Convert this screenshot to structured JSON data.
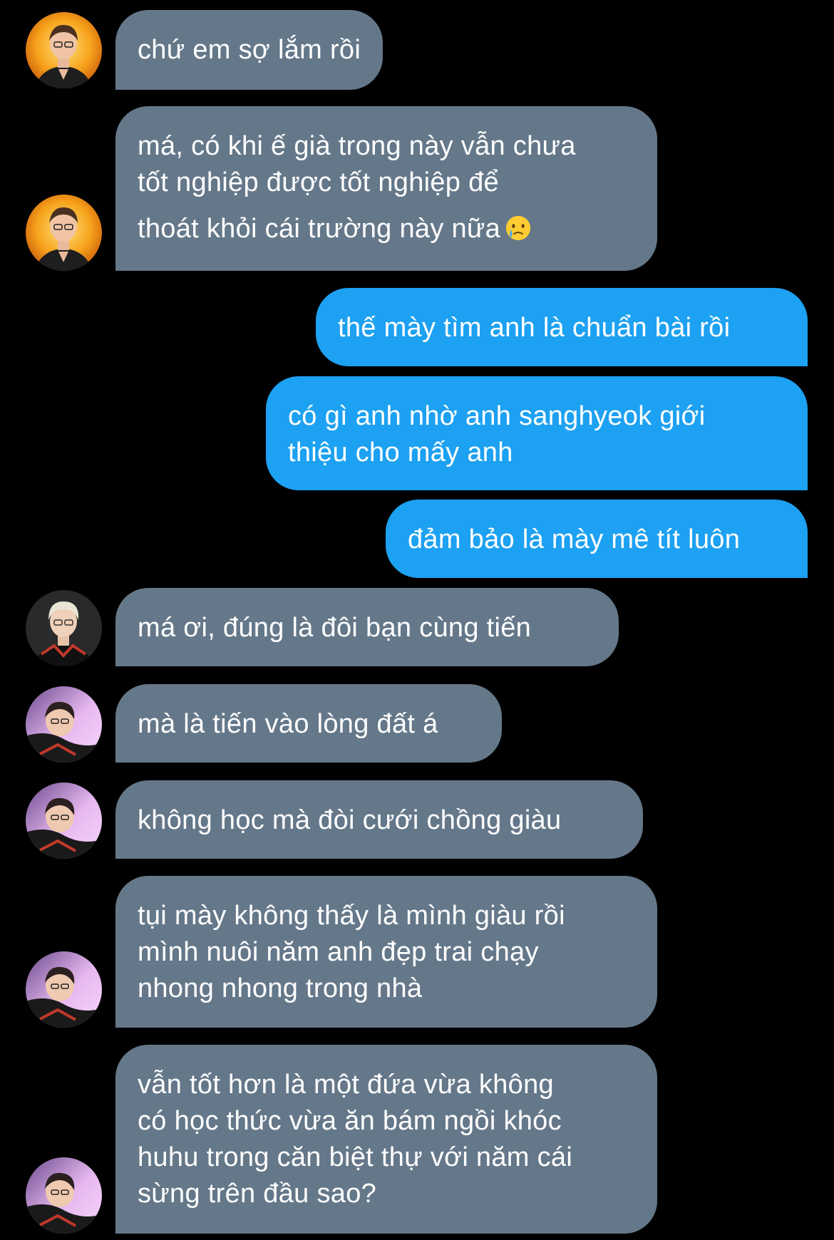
{
  "messages": [
    {
      "side": "in",
      "avatar": "avatar-player-a",
      "lines": [
        "chứ em sợ lắm rồi"
      ]
    },
    {
      "side": "in",
      "avatar": "avatar-player-a",
      "lines": [
        "má, có khi ế già trong này vẫn chưa",
        "tốt nghiệp được tốt nghiệp để",
        "thoát khỏi cái trường này nữa"
      ],
      "emoji": "crying-face-emoji"
    },
    {
      "side": "out",
      "lines": [
        "thế mày tìm anh là chuẩn bài rồi"
      ]
    },
    {
      "side": "out",
      "lines": [
        "có gì anh nhờ anh sanghyeok giới",
        "thiệu cho mấy anh"
      ]
    },
    {
      "side": "out",
      "lines": [
        "đảm bảo là mày mê tít luôn"
      ]
    },
    {
      "side": "in",
      "avatar": "avatar-player-b",
      "lines": [
        "má ơi, đúng là đôi bạn cùng tiến"
      ]
    },
    {
      "side": "in",
      "avatar": "avatar-player-c",
      "lines": [
        "mà là tiến vào lòng đất á"
      ]
    },
    {
      "side": "in",
      "avatar": "avatar-player-c",
      "lines": [
        "không học mà đòi cưới chồng giàu"
      ]
    },
    {
      "side": "in",
      "avatar": "avatar-player-c",
      "lines": [
        "tụi mày không thấy là mình giàu rồi",
        "mình nuôi năm anh đẹp trai chạy",
        "nhong nhong trong nhà"
      ]
    },
    {
      "side": "in",
      "avatar": "avatar-player-c",
      "lines": [
        "vẫn tốt hơn là một đứa vừa không",
        "có học thức vừa ăn bám ngồi khóc",
        "huhu trong căn biệt thự với năm cái",
        "sừng trên đầu sao?"
      ]
    }
  ],
  "colors": {
    "background": "#000000",
    "incoming_bubble": "#65788a",
    "outgoing_bubble": "#1da1f2",
    "text": "#ffffff"
  }
}
